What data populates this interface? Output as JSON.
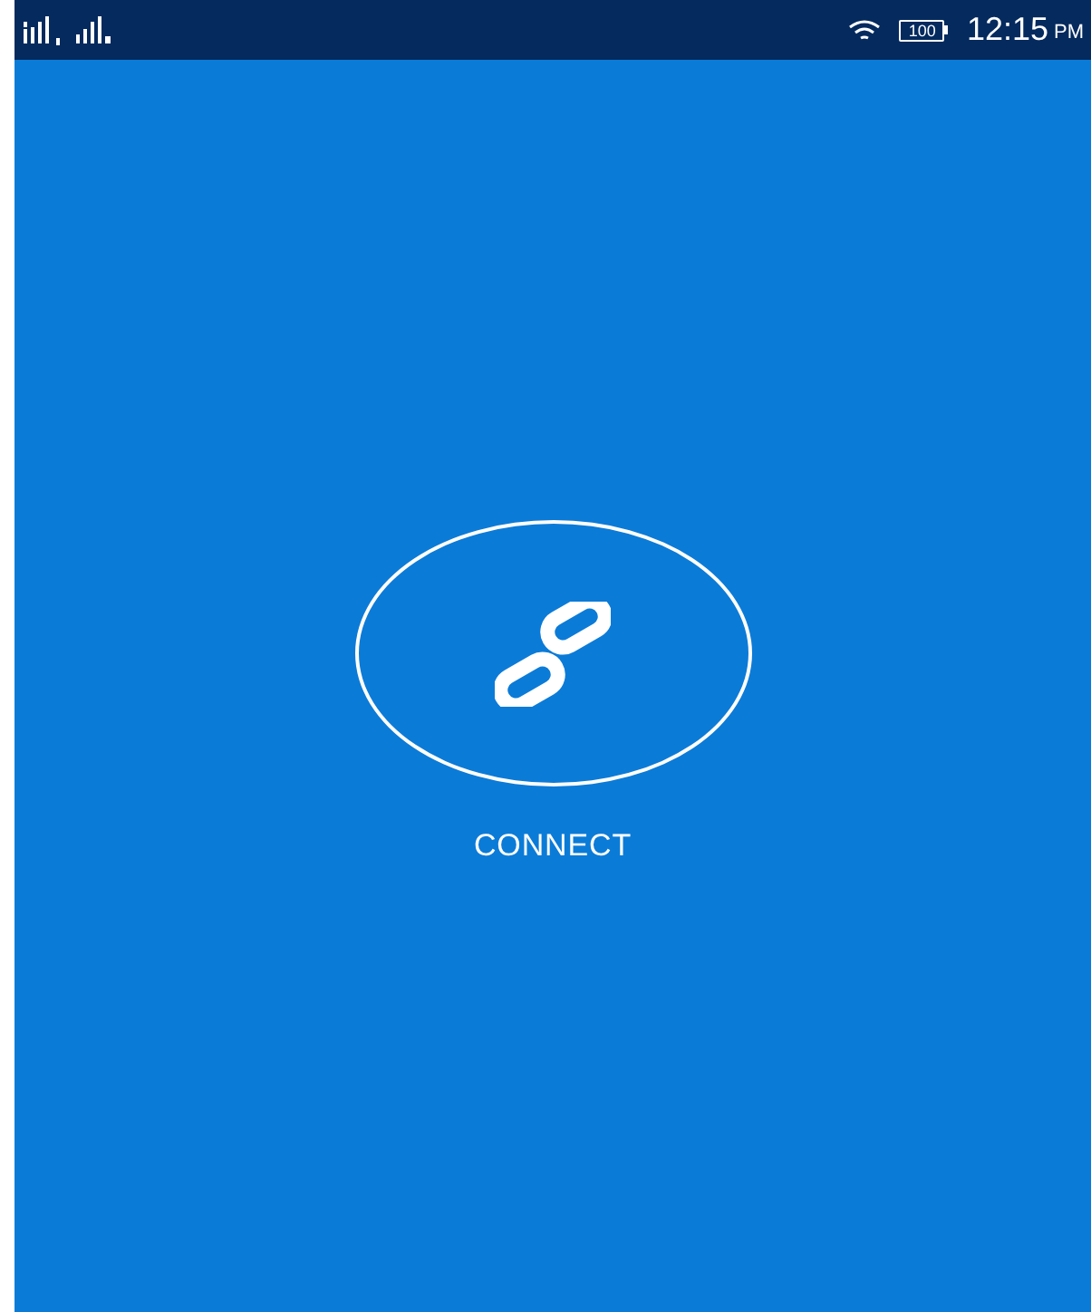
{
  "status_bar": {
    "battery": "100",
    "time": "12:15",
    "meridiem": "PM"
  },
  "connect_button": {
    "label": "CONNECT"
  }
}
